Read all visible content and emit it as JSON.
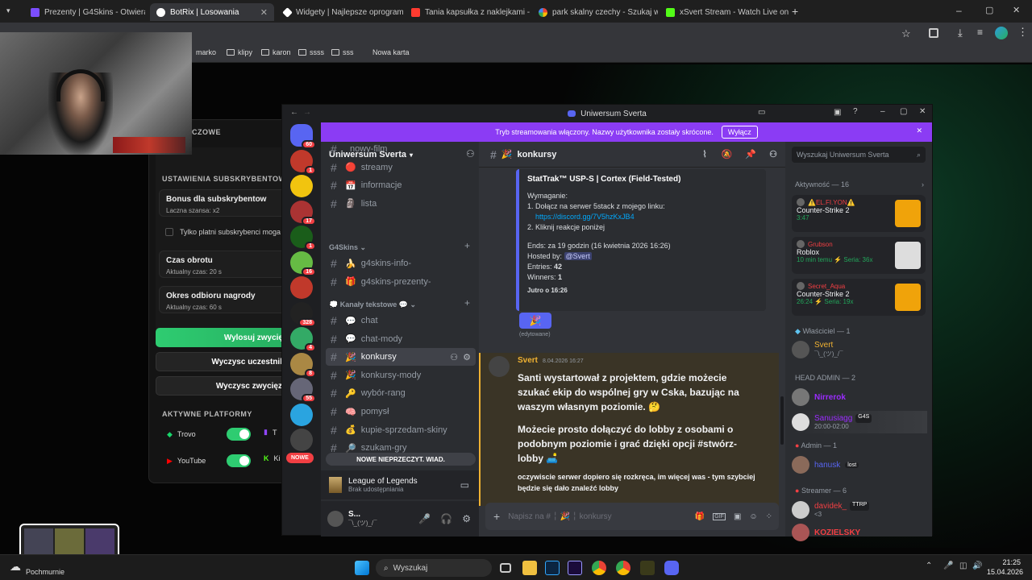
{
  "tabs": [
    {
      "label": "Prezenty | G4Skins - Otwieraj sk",
      "color": "#7b4dff"
    },
    {
      "label": "BotRix | Losowania",
      "color": "#ffffff"
    },
    {
      "label": "Widgety | Najlepsze oprogram",
      "color": "#ffffff"
    },
    {
      "label": "Tania kapsułka z naklejkami - St",
      "color": "#ff3b30"
    },
    {
      "label": "park skalny czechy - Szukaj w G",
      "color": "#ffffff"
    },
    {
      "label": "xSvert Stream - Watch Live on K",
      "color": "#53fc18"
    }
  ],
  "bookmarks": [
    "marko",
    "klipy",
    "karon",
    "ssss",
    "sss",
    "Nowa karta"
  ],
  "botrix": {
    "header_partial": "LUCZOWE",
    "subs_title": "USTAWIENIA SUBSKRYBENTOW",
    "bonus_title": "Bonus dla subskrybentow",
    "bonus_sub": "Laczna szansa: x2",
    "only_subs": "Tylko platni subskrybenci moga",
    "time_title": "Czas obrotu",
    "time_sub": "Aktualny czas: 20 s",
    "claim_title": "Okres odbioru nagrody",
    "claim_sub": "Aktualny czas: 60 s",
    "draw_btn": "Wylosuj zwycię",
    "clear_btn": "Wyczysc uczestnil",
    "clear_win_btn": "Wyczysc zwycięz",
    "platforms_title": "AKTYWNE PLATFORMY",
    "platforms": [
      "Trovo",
      "YouTube"
    ],
    "platforms_partial": [
      "T",
      "Ki"
    ]
  },
  "discord": {
    "window_title": "Uniwersum Sverta",
    "banner_text": "Tryb streamowania włączony. Nazwy użytkownika zostały skrócone.",
    "banner_btn": "Wyłącz",
    "server_name": "Uniwersum Sverta",
    "server_badges": [
      "60",
      "1",
      "",
      "17",
      "1",
      "16",
      "",
      "328",
      "4",
      "8",
      "55",
      "",
      ""
    ],
    "new_label": "NOWE",
    "unread_bar": "NOWE NIEPRZECZYT. WIAD.",
    "channels_top": [
      {
        "name": "nowy-film",
        "icon": ""
      },
      {
        "name": "streamy",
        "icon": "🔴"
      },
      {
        "name": "informacje",
        "icon": "📅"
      },
      {
        "name": "lista",
        "icon": "🗿"
      }
    ],
    "cat_g4": "G4Skins",
    "channels_g4": [
      {
        "name": "g4skins-info-",
        "icon": "🍌"
      },
      {
        "name": "g4skins-prezenty-",
        "icon": "🎁"
      }
    ],
    "cat_text": "Kanały tekstowe",
    "channels_text": [
      {
        "name": "chat",
        "icon": "💬"
      },
      {
        "name": "chat-mody",
        "icon": "💬"
      },
      {
        "name": "konkursy",
        "icon": "🎉"
      },
      {
        "name": "konkursy-mody",
        "icon": "🎉"
      },
      {
        "name": "wybór-rang",
        "icon": "🔑"
      },
      {
        "name": "pomysł",
        "icon": "🧠"
      },
      {
        "name": "kupie-sprzedam-skiny",
        "icon": "💰"
      },
      {
        "name": "szukam-gry",
        "icon": "🔎"
      }
    ],
    "activity_game": "League of Legends",
    "activity_sub": "Brak udostępniania",
    "user_name": "S...",
    "user_status": "¯\\_(ツ)_/¯",
    "channel_header": "konkursy",
    "search_placeholder": "Wyszukaj Uniwersum Sverta",
    "giveaway": {
      "title": "StatTrak™ USP-S | Cortex (Field-Tested)",
      "req": "Wymaganie:",
      "step1": "1. Dołącz na serwer 5stack z mojego linku:",
      "link": "https://discord.gg/7V5hzKxJB4",
      "step2": "2. Kliknij reakcje poniżej",
      "ends_label": "Ends:",
      "ends": "za 19 godzin (16 kwietnia 2026 16:26)",
      "hosted_label": "Hosted by:",
      "host": "@Svert",
      "entries_label": "Entries:",
      "entries": "42",
      "winners_label": "Winners:",
      "winners": "1",
      "footer": "Jutro o 16:26",
      "edited": "(edytowane)"
    },
    "msg_author": "Svert",
    "msg_time": "8.04.2026 16:27",
    "msg_p1": "Santi wystartował z projektem, gdzie możecie szukać ekip do wspólnej gry w Cska, bazując na waszym własnym poziomie. 🤔",
    "msg_p2": "Możecie prosto dołączyć do lobby z osobami o podobnym poziomie i grać dzięki opcji #stwórz-lobby 🛋️",
    "msg_p3": "oczywiscie serwer dopiero się rozkręca, im więcej was - tym szybciej będzie się dało znaleźć lobby",
    "input_placeholder": "Napisz na #  ╎ 🎉 ╎ konkursy",
    "activity_header": "Aktywność — 16",
    "activities": [
      {
        "name": "⚠️EL.FI.YON⚠️",
        "game": "Counter-Strike 2",
        "detail": "3:47",
        "color": "#f23f43"
      },
      {
        "name": "Grubson",
        "game": "Roblox",
        "detail": "10 min temu  ⚡ Seria: 36x",
        "color": "#f23f43"
      },
      {
        "name": "Secret_Aqua",
        "game": "Counter-Strike 2",
        "detail": "26:24  ⚡ Seria: 19x",
        "color": "#f23f43"
      }
    ],
    "owner_header": "Właściciel — 1",
    "owner": {
      "name": "Svert",
      "status": "¯\\_(ツ)_/¯"
    },
    "headadmin_header": "HEAD ADMIN — 2",
    "headadmins": [
      {
        "name": "Nirrerok",
        "color": "#9b2cff"
      },
      {
        "name": "Sanusiagg",
        "color": "#9b2cff",
        "tag": "G4S",
        "status": "20:00-02:00"
      }
    ],
    "admin_header": "Admin — 1",
    "admin": {
      "name": "hanusk",
      "tag": "lost"
    },
    "streamer_header": "Streamer — 6",
    "streamers": [
      {
        "name": "davidek_",
        "tag": "TTRP",
        "status": "<3"
      },
      {
        "name": "KOZIELSKY"
      }
    ]
  },
  "taskbar": {
    "weather": "Pochmurnie",
    "search": "Wyszukaj",
    "time": "21:25",
    "date": "15.04.2026"
  }
}
